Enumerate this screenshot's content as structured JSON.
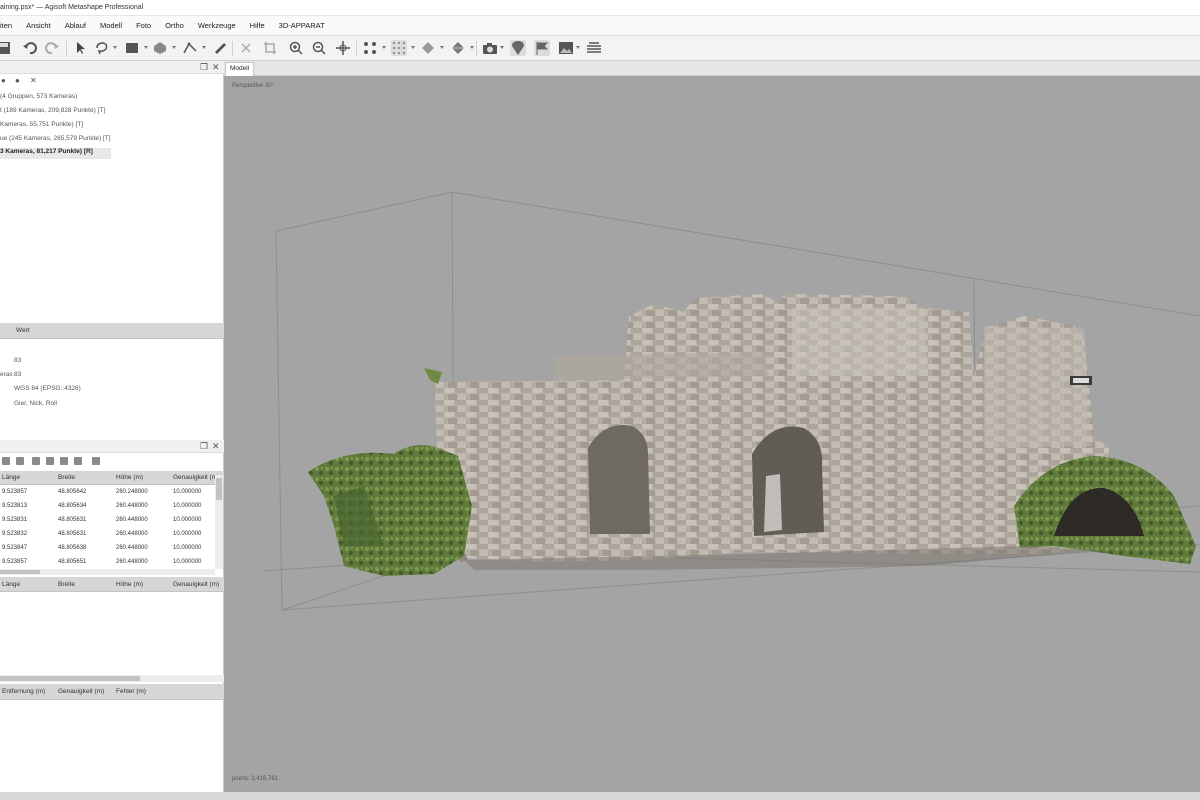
{
  "window": {
    "title": "aining.psx* — Agisoft Metashape Professional"
  },
  "menu": [
    "iten",
    "Ansicht",
    "Ablauf",
    "Modell",
    "Foto",
    "Ortho",
    "Werkzeuge",
    "Hilfe",
    "3D-APPARAT"
  ],
  "toolbar": {
    "icons": [
      "save-icon",
      "undo-icon",
      "redo-icon",
      "select-icon",
      "lasso-icon",
      "rectangle-select-icon",
      "region-icon",
      "ruler-icon",
      "draw-polyline-icon",
      "delete-icon",
      "crop-icon",
      "zoom-in-icon",
      "zoom-out-icon",
      "move-icon",
      "points-icon",
      "grid-points-icon",
      "model-shaded-icon",
      "model-textured-icon",
      "camera-icon",
      "show-markers-icon",
      "flag-icon",
      "image-icon",
      "layers-icon"
    ]
  },
  "workspace": {
    "rows": [
      "(4 Gruppen, 573 Kameras)",
      "t (189 Kameras, 209,828 Punkte) [T]",
      "Kameras, 55,751 Punkte) [T]",
      "ue (245 Kameras, 265,579 Punkte) [T]",
      "3 Kameras, 81,217 Punkte) [R]"
    ]
  },
  "properties": {
    "col_value": "Wert",
    "rows": [
      {
        "key": "",
        "value": "83"
      },
      {
        "key": "eras",
        "value": "83"
      },
      {
        "key": "",
        "value": "WGS 84 (EPSG::4326)"
      },
      {
        "key": "",
        "value": "Gier, Nick, Roll"
      }
    ]
  },
  "reference": {
    "cameras_header": [
      "Länge",
      "Breite",
      "Höhe (m)",
      "Genauigkeit (m)"
    ],
    "cameras": [
      [
        "9.523857",
        "48.805642",
        "260.248000",
        "10.000000"
      ],
      [
        "9.523813",
        "48.805634",
        "260.448000",
        "10.000000"
      ],
      [
        "9.523831",
        "48.805631",
        "260.448000",
        "10.000000"
      ],
      [
        "9.523832",
        "48.805631",
        "260.448000",
        "10.000000"
      ],
      [
        "9.523847",
        "48.805638",
        "260.448000",
        "10.000000"
      ],
      [
        "9.523857",
        "48.805651",
        "260.448000",
        "10.000000"
      ]
    ],
    "markers_header": [
      "Länge",
      "Breite",
      "Höhe (m)",
      "Genauigkeit (m)"
    ],
    "scalebars_header": [
      "Entfernung (m)",
      "Genauigkeit (m)",
      "Fehler (m)"
    ]
  },
  "viewport": {
    "tab": "Modell",
    "perspective_label": "Perspective 30°",
    "points_label": "points: 2,416,761"
  },
  "colors": {
    "viewport_bg": "#a4a4a4",
    "panel_header": "#d6d6d6",
    "stone": "#b9b3ab",
    "foliage": "#5f7a3a"
  }
}
